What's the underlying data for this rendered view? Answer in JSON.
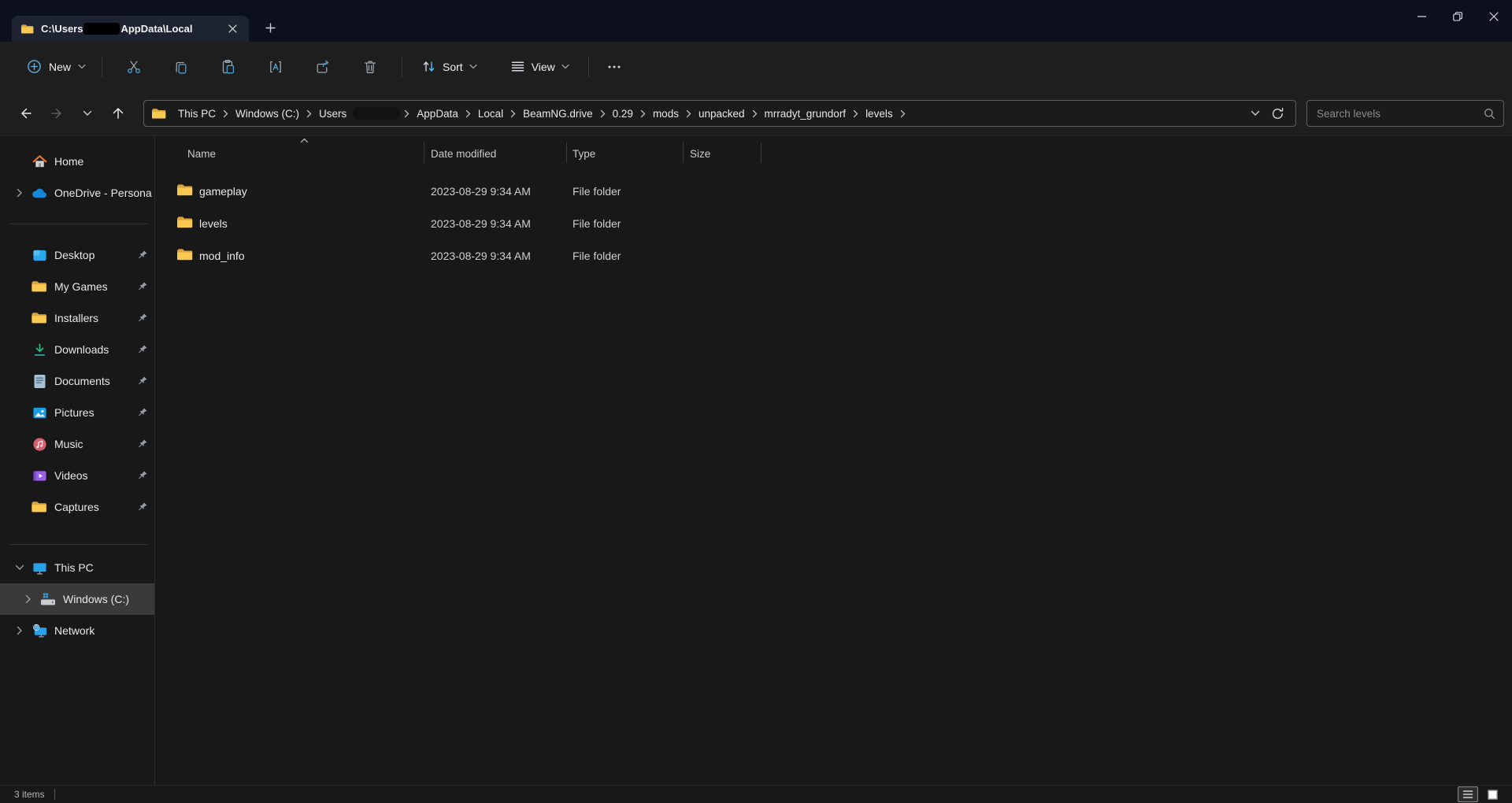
{
  "window": {
    "tab_title_prefix": "C:\\Users",
    "tab_title_suffix": "AppData\\Local"
  },
  "toolbar": {
    "new_label": "New",
    "sort_label": "Sort",
    "view_label": "View"
  },
  "address": {
    "crumbs": [
      "This PC",
      "Windows (C:)",
      "Users",
      "AppData",
      "Local",
      "BeamNG.drive",
      "0.29",
      "mods",
      "unpacked",
      "mrradyt_grundorf",
      "levels"
    ],
    "search_placeholder": "Search levels"
  },
  "sidebar": {
    "home": "Home",
    "onedrive": "OneDrive - Persona",
    "pinned": [
      "Desktop",
      "My Games",
      "Installers",
      "Downloads",
      "Documents",
      "Pictures",
      "Music",
      "Videos",
      "Captures"
    ],
    "this_pc": "This PC",
    "drive_c": "Windows (C:)",
    "network": "Network"
  },
  "files": {
    "columns": [
      "Name",
      "Date modified",
      "Type",
      "Size"
    ],
    "rows": [
      {
        "name": "gameplay",
        "date": "2023-08-29 9:34 AM",
        "type": "File folder",
        "size": ""
      },
      {
        "name": "levels",
        "date": "2023-08-29 9:34 AM",
        "type": "File folder",
        "size": ""
      },
      {
        "name": "mod_info",
        "date": "2023-08-29 9:34 AM",
        "type": "File folder",
        "size": ""
      }
    ]
  },
  "status": {
    "count": "3 items"
  },
  "colors": {
    "accent": "#4cc2ff",
    "folder_front": "#f8c851",
    "folder_back": "#dda33c",
    "titlebar": "#0c101c"
  }
}
